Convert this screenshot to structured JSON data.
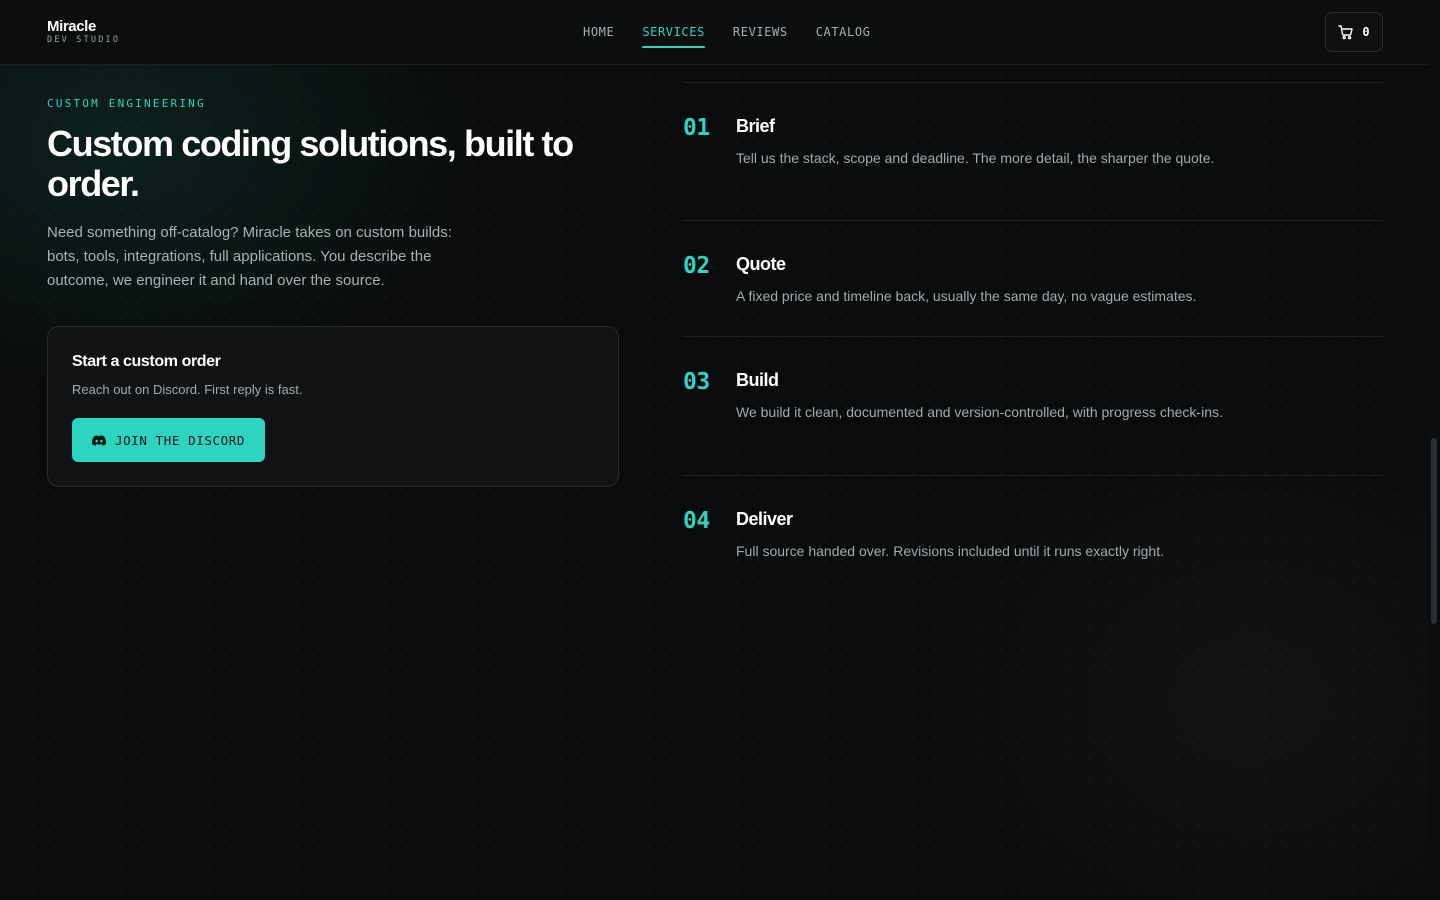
{
  "header": {
    "brand_name": "Miracle",
    "brand_sub": "DEV STUDIO",
    "nav": [
      {
        "label": "HOME",
        "active": false
      },
      {
        "label": "SERVICES",
        "active": true
      },
      {
        "label": "REVIEWS",
        "active": false
      },
      {
        "label": "CATALOG",
        "active": false
      }
    ],
    "cart_icon": "cart-icon",
    "cart_count": "0"
  },
  "hero": {
    "eyebrow": "CUSTOM ENGINEERING",
    "title": "Custom coding solutions, built to order.",
    "lede": "Need something off-catalog? Miracle takes on custom builds: bots, tools, integrations, full applications. You describe the outcome, we engineer it and hand over the source."
  },
  "order_card": {
    "title": "Start a custom order",
    "subtitle": "Reach out on Discord. First reply is fast.",
    "button_icon": "discord-icon",
    "button_label": "JOIN THE DISCORD"
  },
  "steps": [
    {
      "num": "01",
      "title": "Brief",
      "desc": "Tell us the stack, scope and deadline. The more detail, the sharper the quote."
    },
    {
      "num": "02",
      "title": "Quote",
      "desc": "A fixed price and timeline back, usually the same day, no vague estimates."
    },
    {
      "num": "03",
      "title": "Build",
      "desc": "We build it clean, documented and version-controlled, with progress check-ins."
    },
    {
      "num": "04",
      "title": "Deliver",
      "desc": "Full source handed over. Revisions included until it runs exactly right."
    }
  ],
  "colors": {
    "accent": "#2dd4bf",
    "background": "#0a0b0c",
    "card": "#111214"
  }
}
